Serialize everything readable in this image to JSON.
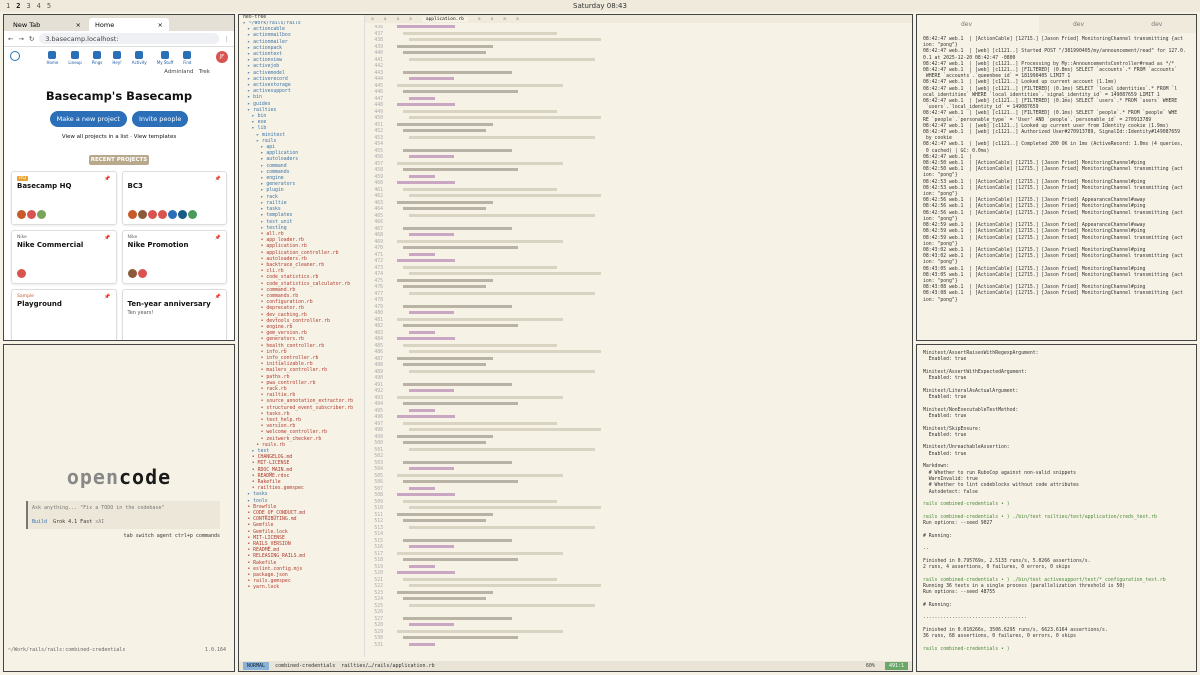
{
  "topbar": {
    "workspaces": [
      "1",
      "2",
      "3",
      "4",
      "5"
    ],
    "active_workspace": "2",
    "clock": "Saturday 08:43"
  },
  "browser": {
    "tabs": [
      {
        "label": "New Tab"
      },
      {
        "label": "Home"
      }
    ],
    "url": "3.basecamp.localhost:",
    "nav": [
      "Home",
      "Lineup",
      "Pings",
      "Hey!",
      "Activity",
      "My Stuff",
      "Find"
    ],
    "user_links": [
      "Adminland",
      "Trek"
    ],
    "avatar_initials": "JF",
    "title": "Basecamp's Basecamp",
    "btn_new": "Make a new project",
    "btn_invite": "Invite people",
    "links_text": "View all projects in a list · View templates",
    "recent_label": "RECENT PROJECTS",
    "cards": [
      {
        "cat": "HQ",
        "name": "Basecamp HQ",
        "desc": ""
      },
      {
        "cat": "",
        "name": "BC3",
        "desc": ""
      },
      {
        "cat": "Nike",
        "name": "Nike Commercial",
        "desc": ""
      },
      {
        "cat": "Nike",
        "name": "Nike Promotion",
        "desc": ""
      },
      {
        "cat": "Sample",
        "name": "Playground",
        "desc": ""
      },
      {
        "cat": "",
        "name": "Ten-year anniversary",
        "desc": "Ten years!"
      }
    ]
  },
  "opencode": {
    "logo_a": "open",
    "logo_b": "code",
    "placeholder": "Ask anything... \"Fix a TODO in the codebase\"",
    "mode": "Build",
    "model": "Grok 4.1 Fast",
    "model_provider": "xAI",
    "hint": "tab switch agent   ctrl+p commands",
    "path": "~/Work/rails/rails:combined-credentials",
    "version": "1.0.164"
  },
  "nvim": {
    "tree_title": "neo-tree",
    "tree": [
      {
        "t": "d",
        "n": "~/Work/rails/rails"
      },
      {
        "t": "d",
        "n": "  actioncable"
      },
      {
        "t": "d",
        "n": "  actionmailbox"
      },
      {
        "t": "d",
        "n": "  actionmailer"
      },
      {
        "t": "d",
        "n": "  actionpack"
      },
      {
        "t": "d",
        "n": "  actiontext"
      },
      {
        "t": "d",
        "n": "  actionview"
      },
      {
        "t": "d",
        "n": "  activejob"
      },
      {
        "t": "d",
        "n": "  activemodel"
      },
      {
        "t": "d",
        "n": "  activerecord"
      },
      {
        "t": "d",
        "n": "  activestorage"
      },
      {
        "t": "d",
        "n": "  activesupport"
      },
      {
        "t": "d",
        "n": "  bin"
      },
      {
        "t": "d",
        "n": "  guides"
      },
      {
        "t": "d",
        "n": "  railties"
      },
      {
        "t": "d",
        "n": "    bin"
      },
      {
        "t": "d",
        "n": "    exe"
      },
      {
        "t": "d",
        "n": "    lib"
      },
      {
        "t": "d",
        "n": "      minitest"
      },
      {
        "t": "d",
        "n": "      rails"
      },
      {
        "t": "d",
        "n": "        api"
      },
      {
        "t": "d",
        "n": "        application"
      },
      {
        "t": "d",
        "n": "        autoloaders"
      },
      {
        "t": "d",
        "n": "        command"
      },
      {
        "t": "d",
        "n": "        commands"
      },
      {
        "t": "d",
        "n": "        engine"
      },
      {
        "t": "d",
        "n": "        generators"
      },
      {
        "t": "d",
        "n": "        plugin"
      },
      {
        "t": "d",
        "n": "        rack"
      },
      {
        "t": "d",
        "n": "        railtie"
      },
      {
        "t": "d",
        "n": "        tasks"
      },
      {
        "t": "d",
        "n": "        templates"
      },
      {
        "t": "d",
        "n": "        test_unit"
      },
      {
        "t": "d",
        "n": "        testing"
      },
      {
        "t": "f",
        "n": "        all.rb"
      },
      {
        "t": "f",
        "n": "        app_loader.rb"
      },
      {
        "t": "f",
        "n": "        application.rb"
      },
      {
        "t": "f",
        "n": "        application_controller.rb"
      },
      {
        "t": "f",
        "n": "        autoloaders.rb"
      },
      {
        "t": "f",
        "n": "        backtrace_cleaner.rb"
      },
      {
        "t": "f",
        "n": "        cli.rb"
      },
      {
        "t": "f",
        "n": "        code_statistics.rb"
      },
      {
        "t": "f",
        "n": "        code_statistics_calculator.rb"
      },
      {
        "t": "f",
        "n": "        command.rb"
      },
      {
        "t": "f",
        "n": "        commands.rb"
      },
      {
        "t": "f",
        "n": "        configuration.rb"
      },
      {
        "t": "f",
        "n": "        deprecator.rb"
      },
      {
        "t": "f",
        "n": "        dev_caching.rb"
      },
      {
        "t": "f",
        "n": "        devtools_controller.rb"
      },
      {
        "t": "f",
        "n": "        engine.rb"
      },
      {
        "t": "f",
        "n": "        gem_version.rb"
      },
      {
        "t": "f",
        "n": "        generators.rb"
      },
      {
        "t": "f",
        "n": "        health_controller.rb"
      },
      {
        "t": "f",
        "n": "        info.rb"
      },
      {
        "t": "f",
        "n": "        info_controller.rb"
      },
      {
        "t": "f",
        "n": "        initializable.rb"
      },
      {
        "t": "f",
        "n": "        mailers_controller.rb"
      },
      {
        "t": "f",
        "n": "        paths.rb"
      },
      {
        "t": "f",
        "n": "        pwa_controller.rb"
      },
      {
        "t": "f",
        "n": "        rack.rb"
      },
      {
        "t": "f",
        "n": "        railtie.rb"
      },
      {
        "t": "f",
        "n": "        source_annotation_extractor.rb"
      },
      {
        "t": "f",
        "n": "        structured_event_subscriber.rb"
      },
      {
        "t": "f",
        "n": "        tasks.rb"
      },
      {
        "t": "f",
        "n": "        test_help.rb"
      },
      {
        "t": "f",
        "n": "        version.rb"
      },
      {
        "t": "f",
        "n": "        welcome_controller.rb"
      },
      {
        "t": "f",
        "n": "        zeitwerk_checker.rb"
      },
      {
        "t": "f",
        "n": "      rails.rb"
      },
      {
        "t": "d",
        "n": "    test"
      },
      {
        "t": "f",
        "n": "    CHANGELOG.md"
      },
      {
        "t": "f",
        "n": "    MIT-LICENSE"
      },
      {
        "t": "f",
        "n": "    RDOC_MAIN.md"
      },
      {
        "t": "f",
        "n": "    README.rdoc"
      },
      {
        "t": "f",
        "n": "    Rakefile"
      },
      {
        "t": "f",
        "n": "    railties.gemspec"
      },
      {
        "t": "d",
        "n": "  tasks"
      },
      {
        "t": "d",
        "n": "  tools"
      },
      {
        "t": "f",
        "n": "  Brewfile"
      },
      {
        "t": "f",
        "n": "  CODE_OF_CONDUCT.md"
      },
      {
        "t": "f",
        "n": "  CONTRIBUTING.md"
      },
      {
        "t": "f",
        "n": "  Gemfile"
      },
      {
        "t": "f",
        "n": "  Gemfile.lock"
      },
      {
        "t": "f",
        "n": "  MIT-LICENSE"
      },
      {
        "t": "f",
        "n": "  RAILS_VERSION"
      },
      {
        "t": "f",
        "n": "  README.md"
      },
      {
        "t": "f",
        "n": "  RELEASING_RAILS.md"
      },
      {
        "t": "f",
        "n": "  Rakefile"
      },
      {
        "t": "f",
        "n": "  eslint.config.mjs"
      },
      {
        "t": "f",
        "n": "  package.json"
      },
      {
        "t": "f",
        "n": "  rails.gemspec"
      },
      {
        "t": "f",
        "n": "  yarn.lock"
      }
    ],
    "tabs": [
      "a",
      "a",
      "a",
      "a",
      "application.rb",
      "a",
      "a",
      "a",
      "a"
    ],
    "active_tab": "application.rb",
    "status_mode": "NORMAL",
    "status_branch": "combined-credentials",
    "status_file": "railties/…/rails/application.rb",
    "status_pos": "491:1",
    "status_pct": "60%"
  },
  "term1": {
    "tabs": [
      "dev",
      "dev",
      "dev"
    ],
    "lines": [
      "08:42:47 web.1  | [ActionCable] [12715.] [Jason Fried] MonitoringChannel transmitting {act",
      "ion: \"pong\"}",
      "08:42:47 web.1  | [web] [c1121..] Started POST \"/381990405/my/announcement/read\" for 127.0.",
      "0.1 at 2025-12-20 08:42:47 -0800",
      "08:42:47 web.1  | [web] [c1121..] Processing by My::AnnouncementsController#read as */*",
      "08:42:47 web.1  | [web] [c1121..] [FILTERED] (0.8ms) SELECT `accounts`.* FROM `accounts`",
      " WHERE `accounts`.`queenbee_id` = 181990405 LIMIT 1",
      "08:42:47 web.1  | [web] [c1121..] Looked up current account (1.1ms)",
      "08:42:47 web.1  | [web] [c1121..] [FILTERED] (0.1ms) SELECT `local_identities`.* FROM `l",
      "ocal_identities` WHERE `local_identities`.`signal_identity_id` = 149087659 LIMIT 1",
      "08:42:47 web.1  | [web] [c1121..] [FILTERED] (0.1ms) SELECT `users`.* FROM `users` WHERE",
      " `users`.`local_identity_id` = 149087659",
      "08:42:47 web.1  | [web] [c1121..] [FILTERED] (0.1ms) SELECT `people`.* FROM `people` WHE",
      "RE `people`.`personable_type` = 'User' AND `people`.`personable_id` = 270913789",
      "08:42:47 web.1  | [web] [c1121..] Looked up current user from Identity cookie (1.9ms)",
      "08:42:47 web.1  | [web] [c1121..] Authorized User#270913789, SignalId::Identity#149087659",
      " by cookie",
      "08:42:47 web.1  | [web] [c1121..] Completed 200 OK in 1ms (ActiveRecord: 1.0ms (4 queries,",
      " 0 cached) | GC: 0.0ms)",
      "08:42:47 web.1  |",
      "08:42:50 web.1  | [ActionCable] [12715.] [Jason Fried] MonitoringChannel#ping",
      "08:42:50 web.1  | [ActionCable] [12715.] [Jason Fried] MonitoringChannel transmitting {act",
      "ion: \"pong\"}",
      "08:42:53 web.1  | [ActionCable] [12715.] [Jason Fried] MonitoringChannel#ping",
      "08:42:53 web.1  | [ActionCable] [12715.] [Jason Fried] MonitoringChannel transmitting {act",
      "ion: \"pong\"}",
      "08:42:56 web.1  | [ActionCable] [12715.] [Jason Fried] AppearanceChannel#away",
      "08:42:56 web.1  | [ActionCable] [12715.] [Jason Fried] MonitoringChannel#ping",
      "08:42:56 web.1  | [ActionCable] [12715.] [Jason Fried] MonitoringChannel transmitting {act",
      "ion: \"pong\"}",
      "08:42:59 web.1  | [ActionCable] [12715.] [Jason Fried] AppearanceChannel#away",
      "08:42:59 web.1  | [ActionCable] [12715.] [Jason Fried] MonitoringChannel#ping",
      "08:42:59 web.1  | [ActionCable] [12715.] [Jason Fried] MonitoringChannel transmitting {act",
      "ion: \"pong\"}",
      "08:43:02 web.1  | [ActionCable] [12715.] [Jason Fried] MonitoringChannel#ping",
      "08:43:02 web.1  | [ActionCable] [12715.] [Jason Fried] MonitoringChannel transmitting {act",
      "ion: \"pong\"}",
      "08:43:05 web.1  | [ActionCable] [12715.] [Jason Fried] MonitoringChannel#ping",
      "08:43:05 web.1  | [ActionCable] [12715.] [Jason Fried] MonitoringChannel transmitting {act",
      "ion: \"pong\"}",
      "08:43:08 web.1  | [ActionCable] [12715.] [Jason Fried] MonitoringChannel#ping",
      "08:43:08 web.1  | [ActionCable] [12715.] [Jason Fried] MonitoringChannel transmitting {act",
      "ion: \"pong\"}"
    ]
  },
  "term2": {
    "lines": [
      "Minitest/AssertRaisesWithRegexpArgument:",
      "  Enabled: true",
      "",
      "Minitest/AssertWithExpectedArgument:",
      "  Enabled: true",
      "",
      "Minitest/LiteralAsActualArgument:",
      "  Enabled: true",
      "",
      "Minitest/NonExecutableTestMethod:",
      "  Enabled: true",
      "",
      "Minitest/SkipEnsure:",
      "  Enabled: true",
      "",
      "Minitest/UnreachableAssertion:",
      "  Enabled: true",
      "",
      "Markdown:",
      "  # Whether to run RuboCop against non-valid snippets",
      "  WarnInvalid: true",
      "  # Whether to lint codeblocks without code attributes",
      "  Autodetect: false",
      "",
      "rails combined-credentials • ) ",
      "",
      "rails combined-credentials • ) ./bin/test railties/test/application/creds_test.rb",
      "Run options: --seed 9027",
      "",
      "# Running:",
      "",
      "..",
      "",
      "Finished in 0.795769s, 2.5133 runs/s, 5.0266 assertions/s.",
      "2 runs, 4 assertions, 0 failures, 0 errors, 0 skips",
      "",
      "rails combined-credentials • ) ./bin/test activesupport/test/*_configuration_test.rb",
      "Running 36 tests in a single process (parallelization threshold is 50)",
      "Run options: --seed 48755",
      "",
      "# Running:",
      "",
      "....................................",
      "",
      "Finished in 0.010266s, 3506.6295 runs/s, 6623.6164 assertions/s.",
      "36 runs, 68 assertions, 0 failures, 0 errors, 0 skips",
      "",
      "rails combined-credentials • ) "
    ]
  }
}
